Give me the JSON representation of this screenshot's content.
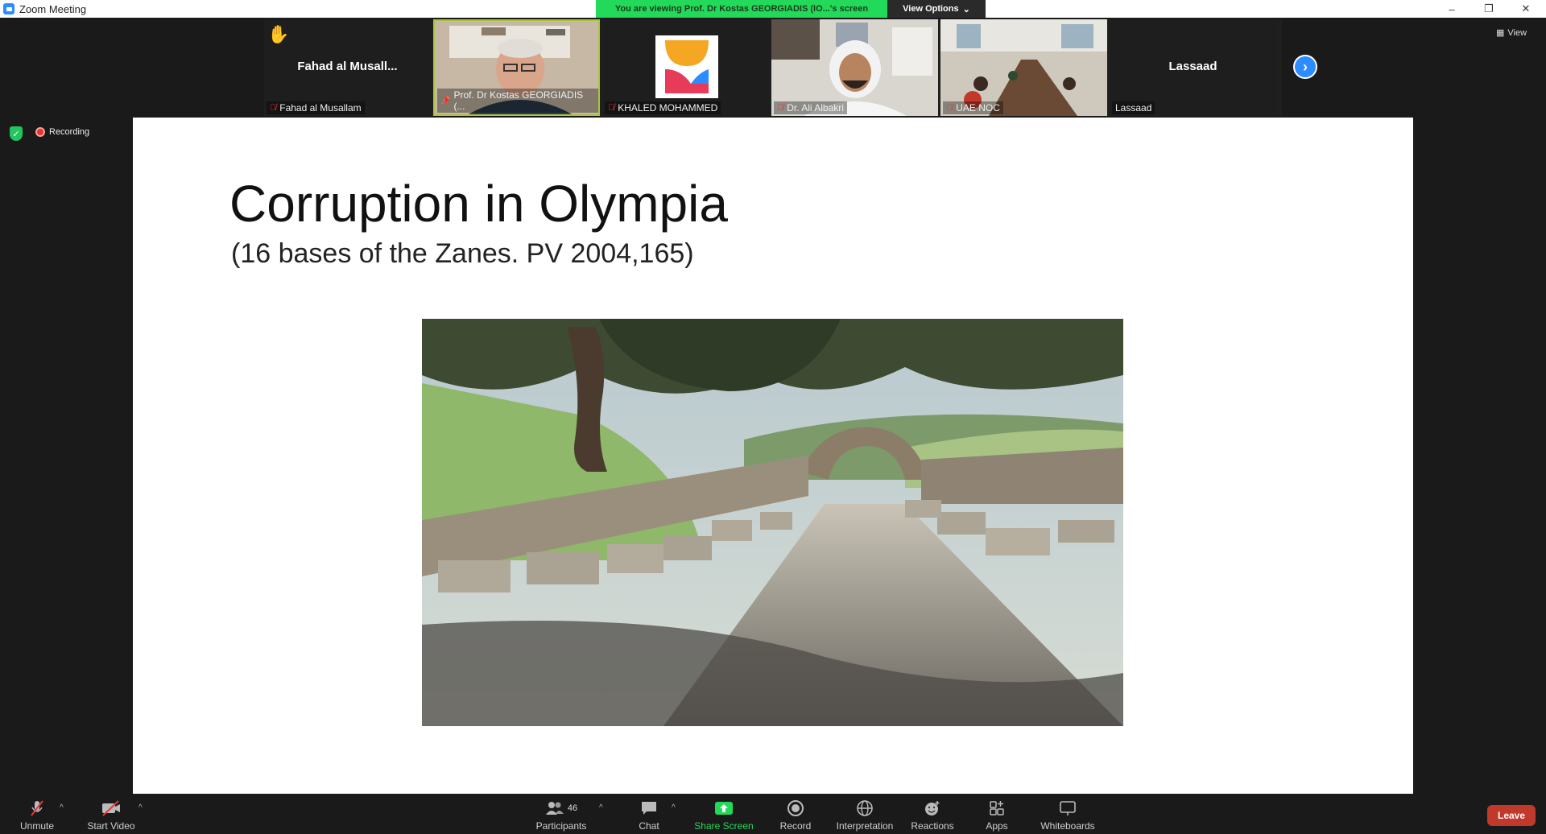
{
  "window": {
    "title": "Zoom Meeting",
    "minimize": "–",
    "restore": "❐",
    "close": "✕"
  },
  "banner": {
    "viewing_text": "You are viewing Prof. Dr Kostas GEORGIADIS (IO...'s screen",
    "view_options_label": "View Options",
    "view_options_caret": "⌄"
  },
  "gallery": {
    "tiles": [
      {
        "name": "Fahad al Musallam",
        "display_name": "Fahad al Musall...",
        "raised_hand": "✋"
      },
      {
        "name": "Prof. Dr Kostas GEORGIADIS (..."
      },
      {
        "name": "KHALED MOHAMMED"
      },
      {
        "name": "Dr. Ali Albakri"
      },
      {
        "name": "UAE NOC"
      },
      {
        "name": "Lassaad",
        "display_name": "Lassaad"
      }
    ],
    "next_label": "›",
    "view_label": "View"
  },
  "status": {
    "recording_label": "Recording"
  },
  "slide": {
    "title": "Corruption in Olympia",
    "subtitle": "(16 bases of the Zanes. PV 2004,165)"
  },
  "toolbar": {
    "unmute": "Unmute",
    "start_video": "Start Video",
    "participants": "Participants",
    "participants_count": "46",
    "chat": "Chat",
    "share_screen": "Share Screen",
    "record": "Record",
    "interpretation": "Interpretation",
    "reactions": "Reactions",
    "apps": "Apps",
    "whiteboards": "Whiteboards",
    "leave": "Leave",
    "caret": "^"
  },
  "colors": {
    "zoom_blue": "#2d8cff",
    "banner_green": "#23d959",
    "leave_red": "#c0392b"
  }
}
